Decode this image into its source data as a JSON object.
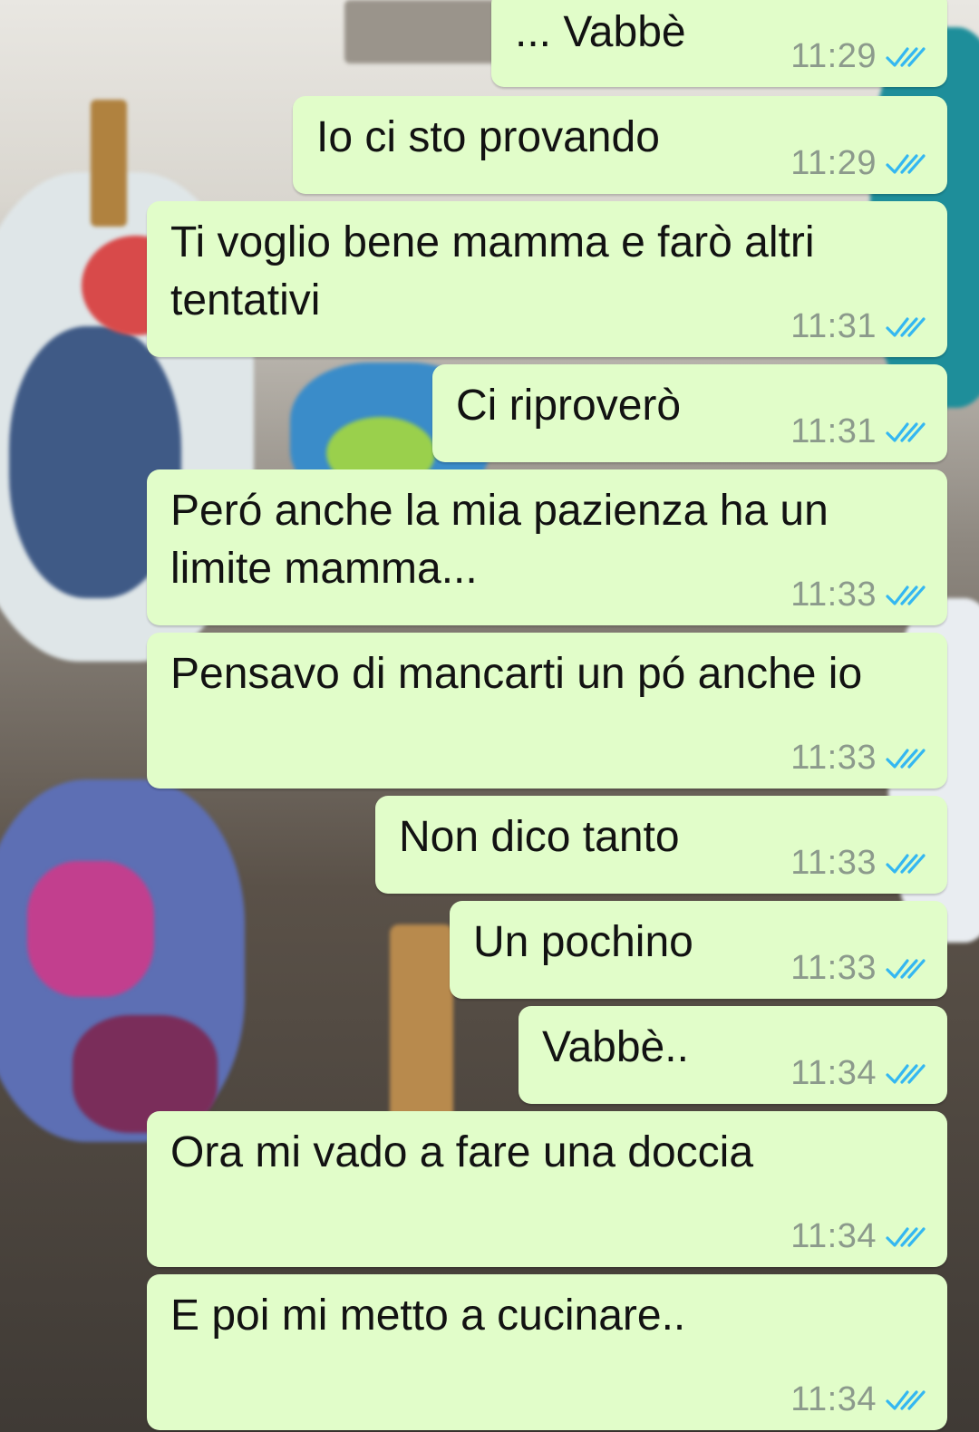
{
  "colors": {
    "bubble_bg": "#e1fdc9",
    "time_color": "#8c9a8c",
    "read_tick_color": "#34b7f1"
  },
  "messages": [
    {
      "text": "... Vabbè",
      "time": "11:29",
      "status": "read"
    },
    {
      "text": "Io ci sto provando",
      "time": "11:29",
      "status": "read"
    },
    {
      "text": "Ti voglio bene mamma e farò altri tentativi",
      "time": "11:31",
      "status": "read"
    },
    {
      "text": "Ci riproverò",
      "time": "11:31",
      "status": "read"
    },
    {
      "text": "Peró anche la mia pazienza ha un limite mamma...",
      "time": "11:33",
      "status": "read"
    },
    {
      "text": "Pensavo di mancarti un pó anche io",
      "time": "11:33",
      "status": "read"
    },
    {
      "text": "Non dico tanto",
      "time": "11:33",
      "status": "read"
    },
    {
      "text": "Un pochino",
      "time": "11:33",
      "status": "read"
    },
    {
      "text": "Vabbè..",
      "time": "11:34",
      "status": "read"
    },
    {
      "text": "Ora mi vado a fare una doccia",
      "time": "11:34",
      "status": "read"
    },
    {
      "text": "E poi mi metto a cucinare..",
      "time": "11:34",
      "status": "read"
    }
  ]
}
